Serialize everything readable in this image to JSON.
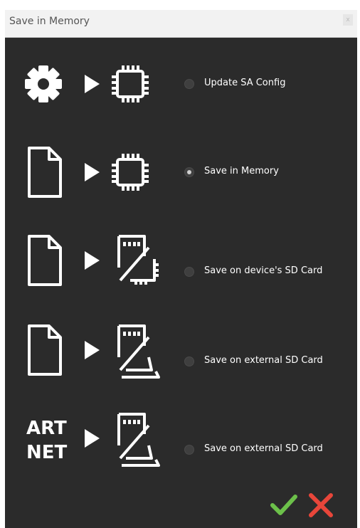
{
  "window": {
    "title": "Save in Memory",
    "close_label": "x"
  },
  "options": [
    {
      "label": "Update SA Config",
      "selected": false,
      "source": "gear-icon",
      "target": "chip-icon"
    },
    {
      "label": "Save in Memory",
      "selected": true,
      "source": "file-icon",
      "target": "chip-icon"
    },
    {
      "label": "Save on device's SD Card",
      "selected": false,
      "source": "file-icon",
      "target": "sd-card-chip-icon"
    },
    {
      "label": "Save on external SD Card",
      "selected": false,
      "source": "file-icon",
      "target": "sd-card-external-icon"
    },
    {
      "label": "Save on external SD Card",
      "selected": false,
      "source": "artnet-icon",
      "target": "sd-card-external-icon",
      "source_text": [
        "ART",
        "NET"
      ]
    }
  ],
  "buttons": {
    "confirm": {
      "icon": "check-icon",
      "color": "#6cc04a"
    },
    "cancel": {
      "icon": "x-icon",
      "color": "#e8463a"
    }
  },
  "colors": {
    "background": "#2b2b2b",
    "titlebar": "#f2f2f2",
    "icon": "#ffffff",
    "label": "#ffffff"
  }
}
